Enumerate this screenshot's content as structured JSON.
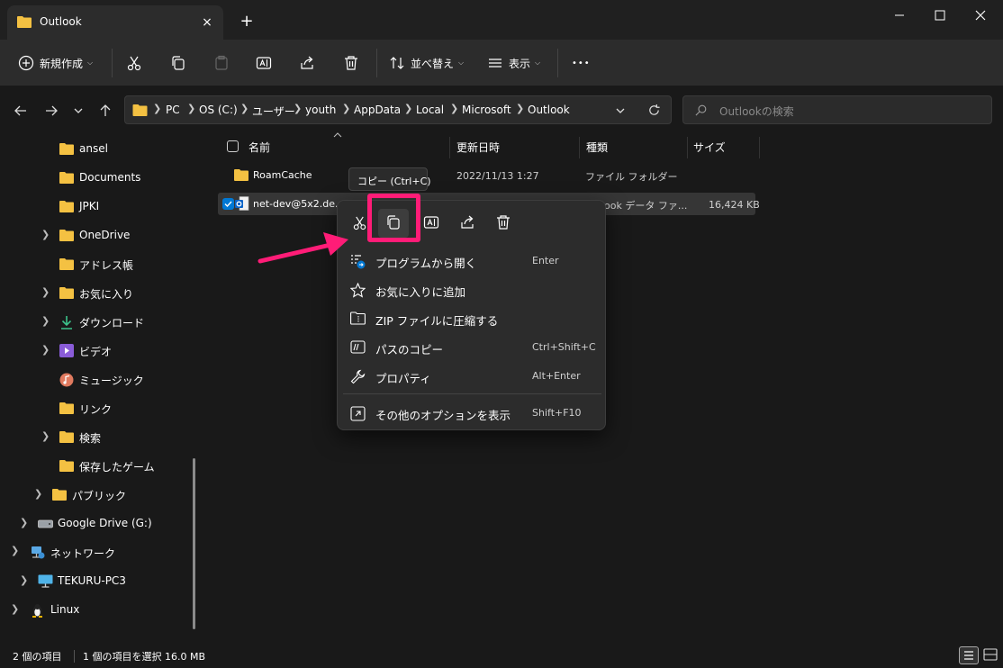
{
  "window": {
    "tab_title": "Outlook",
    "tab_close_glyph": "×",
    "new_tab_glyph": "+"
  },
  "toolbar": {
    "new_label": "新規作成",
    "sort_label": "並べ替え",
    "view_label": "表示",
    "more_glyph": "•••"
  },
  "address": {
    "crumbs": [
      "PC",
      "OS (C:)",
      "ユーザー",
      "youth",
      "AppData",
      "Local",
      "Microsoft",
      "Outlook"
    ],
    "search_placeholder": "Outlookの検索"
  },
  "sidebar": {
    "items": [
      {
        "label": "ansel",
        "icon": "folder-icon",
        "expandable": false
      },
      {
        "label": "Documents",
        "icon": "folder-icon",
        "expandable": false
      },
      {
        "label": "JPKI",
        "icon": "folder-icon",
        "expandable": false
      },
      {
        "label": "OneDrive",
        "icon": "folder-icon",
        "expandable": true
      },
      {
        "label": "アドレス帳",
        "icon": "folder-icon",
        "expandable": false
      },
      {
        "label": "お気に入り",
        "icon": "folder-icon",
        "expandable": true
      },
      {
        "label": "ダウンロード",
        "icon": "download-icon",
        "expandable": true
      },
      {
        "label": "ビデオ",
        "icon": "video-icon",
        "expandable": true
      },
      {
        "label": "ミュージック",
        "icon": "music-icon",
        "expandable": false
      },
      {
        "label": "リンク",
        "icon": "folder-icon",
        "expandable": false
      },
      {
        "label": "検索",
        "icon": "folder-icon",
        "expandable": true
      },
      {
        "label": "保存したゲーム",
        "icon": "folder-icon",
        "expandable": false
      },
      {
        "label": "パブリック",
        "icon": "folder-icon",
        "expandable": true
      },
      {
        "label": "Google Drive (G:)",
        "icon": "drive-icon",
        "expandable": true
      },
      {
        "label": "ネットワーク",
        "icon": "network-icon",
        "expandable": true
      },
      {
        "label": "TEKURU-PC3",
        "icon": "computer-icon",
        "expandable": true
      },
      {
        "label": "Linux",
        "icon": "linux-icon",
        "expandable": true
      }
    ]
  },
  "columns": {
    "name": "名前",
    "date": "更新日時",
    "type": "種類",
    "size": "サイズ"
  },
  "files": [
    {
      "name": "RoamCache",
      "date": "2022/11/13 1:27",
      "type": "ファイル フォルダー",
      "size": ""
    },
    {
      "name": "net-dev@5x2.de.c",
      "date": "",
      "type": "look データ ファ...",
      "size": "16,424 KB"
    }
  ],
  "tooltip": "コピー (Ctrl+C)",
  "context_menu": {
    "items": [
      {
        "label": "プログラムから開く",
        "shortcut": "Enter",
        "icon": "open-with-icon"
      },
      {
        "label": "お気に入りに追加",
        "shortcut": "",
        "icon": "star-icon"
      },
      {
        "label": "ZIP ファイルに圧縮する",
        "shortcut": "",
        "icon": "zip-folder-icon"
      },
      {
        "label": "パスのコピー",
        "shortcut": "Ctrl+Shift+C",
        "icon": "copy-path-icon"
      },
      {
        "label": "プロパティ",
        "shortcut": "Alt+Enter",
        "icon": "wrench-icon"
      },
      {
        "label": "その他のオプションを表示",
        "shortcut": "Shift+F10",
        "icon": "more-options-icon"
      }
    ]
  },
  "status": {
    "count": "2 個の項目",
    "selected": "1 個の項目を選択  16.0 MB"
  },
  "colors": {
    "accent": "#0078d4",
    "highlight": "#ff1c77",
    "folder": "#f4c142"
  }
}
